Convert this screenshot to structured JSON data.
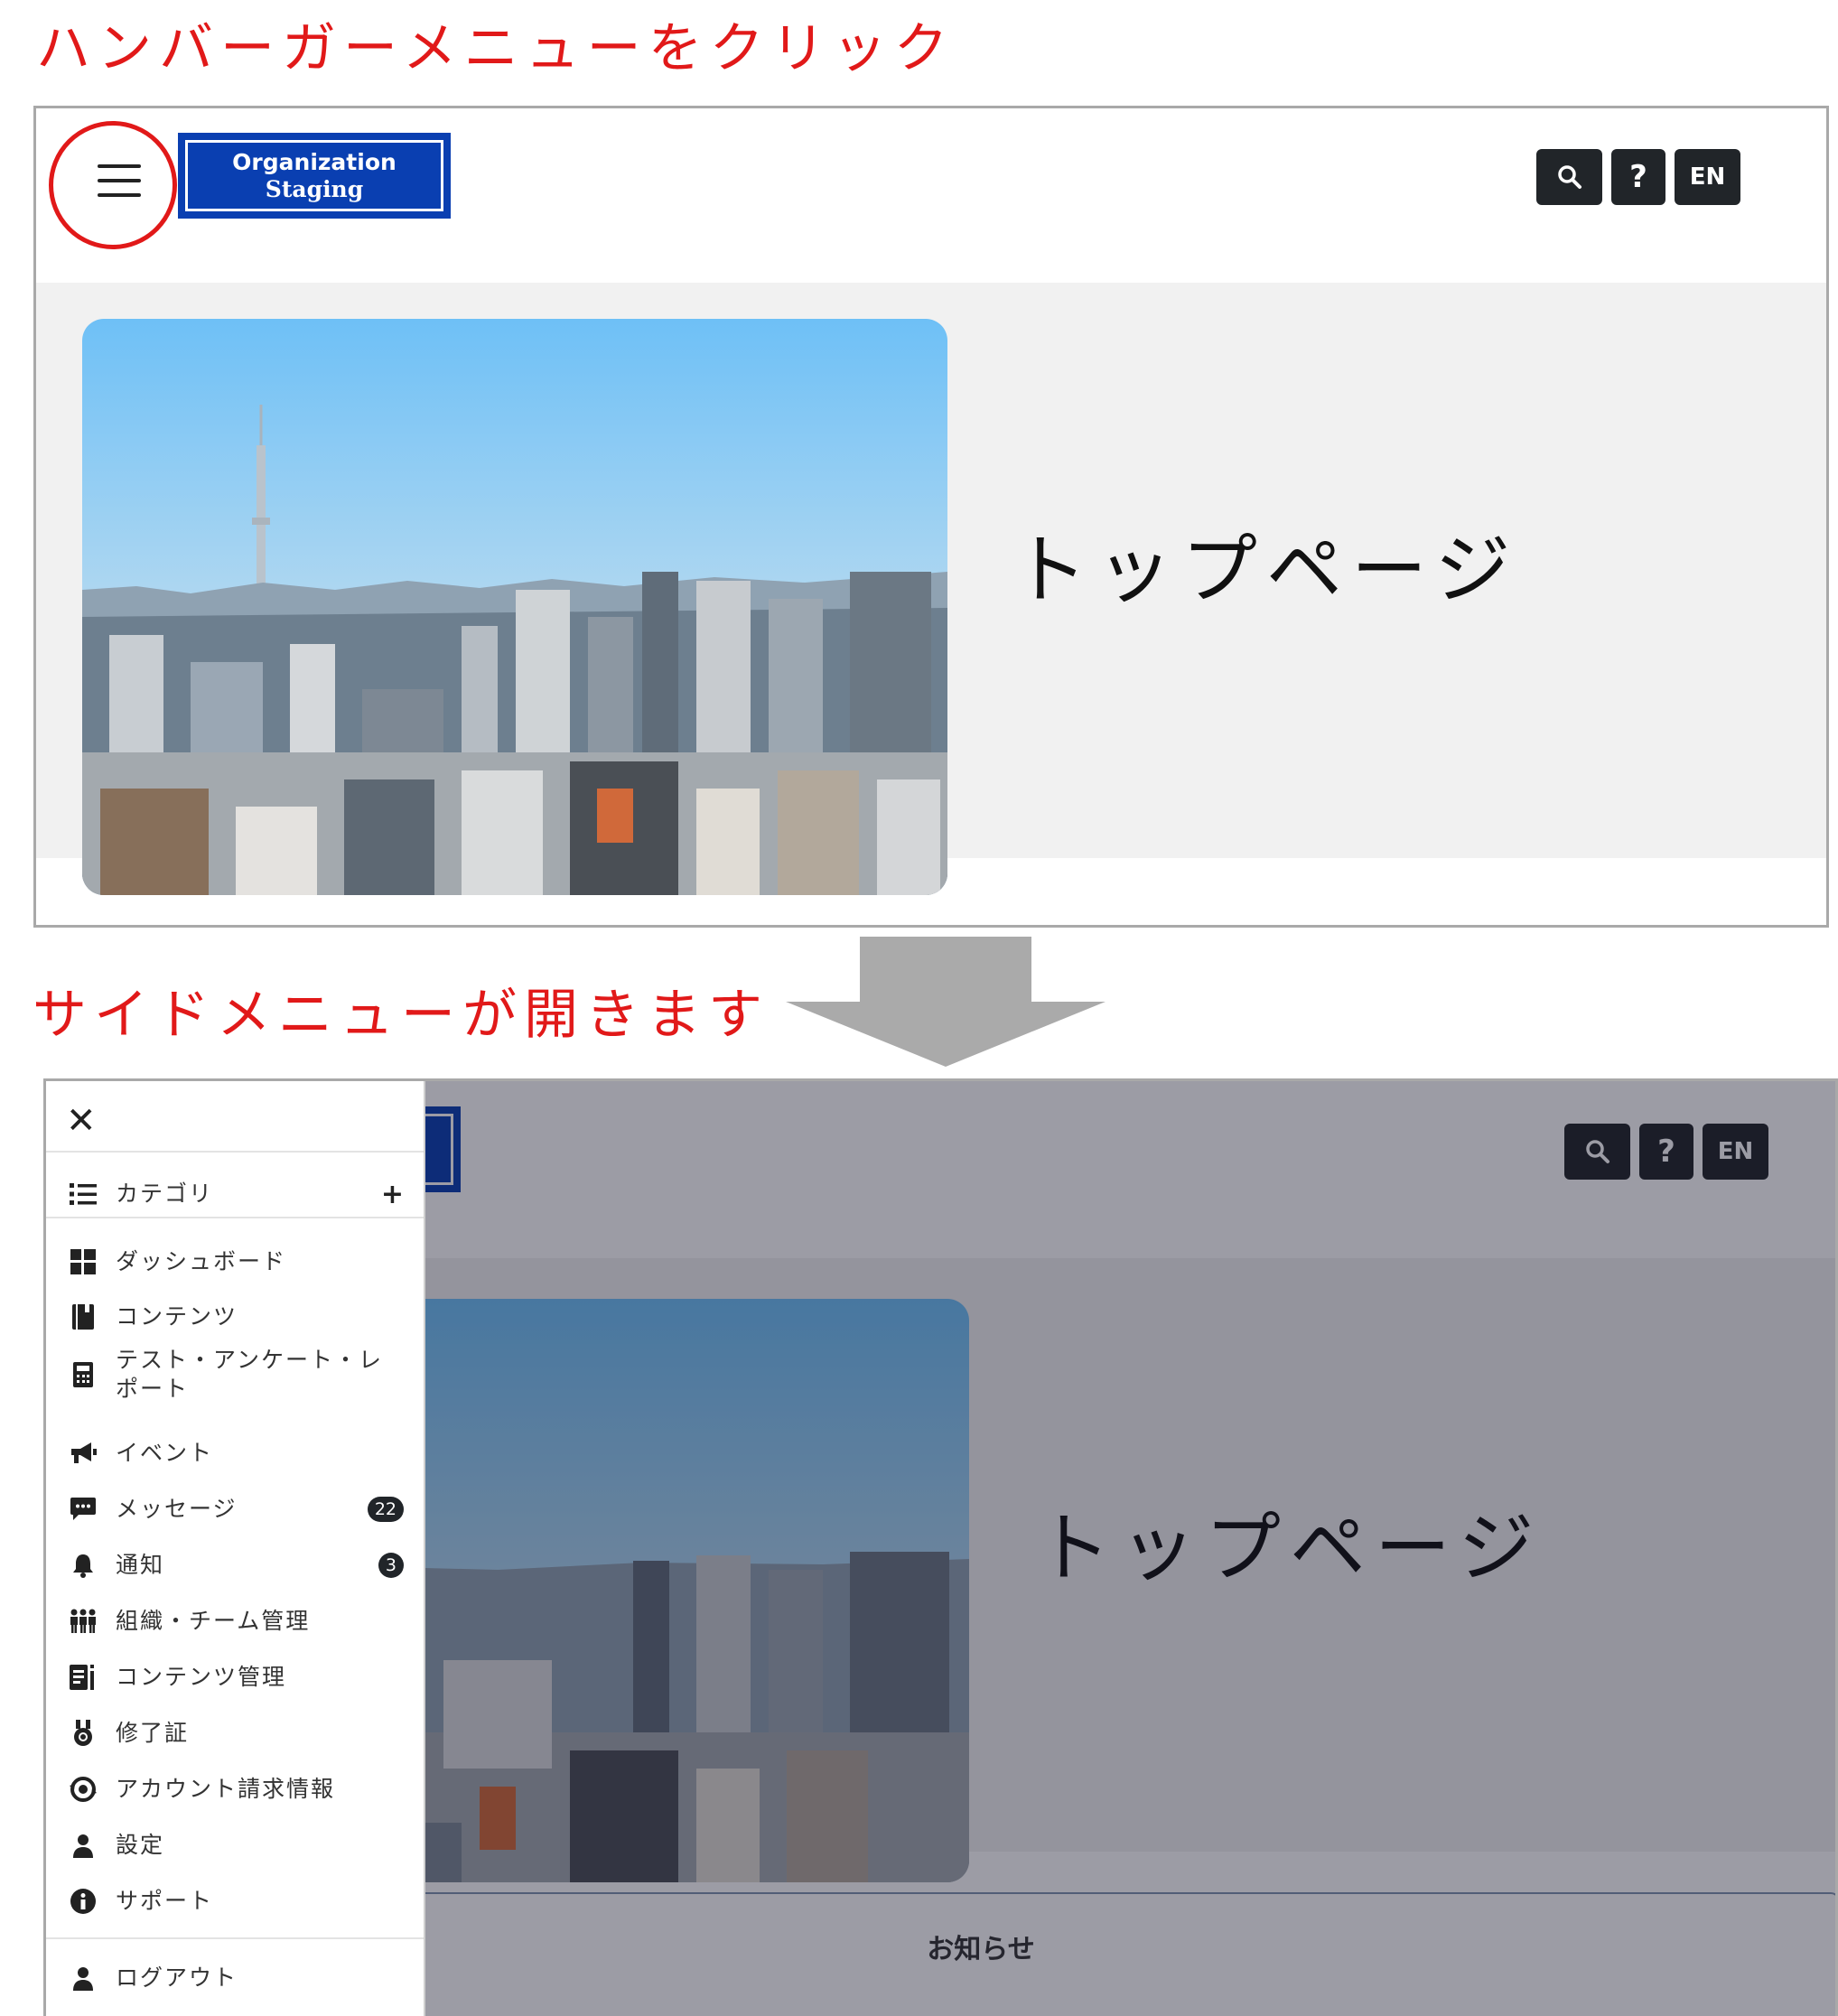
{
  "captions": {
    "step1": "ハンバーガーメニューをクリック",
    "step2": "サイドメニューが開きます"
  },
  "header": {
    "logo_line1": "Organization",
    "logo_line2": "Staging",
    "lang_label": "EN",
    "help_label": "?"
  },
  "hero": {
    "title": "トップページ"
  },
  "notice": {
    "title": "お知らせ"
  },
  "side_menu": {
    "close_label": "✕",
    "category": {
      "label": "カテゴリ",
      "expand": "+"
    },
    "items": [
      {
        "label": "ダッシュボード",
        "icon": "dashboard-icon"
      },
      {
        "label": "コンテンツ",
        "icon": "book-icon"
      },
      {
        "label": "テスト・アンケート・レポート",
        "icon": "calculator-icon"
      },
      {
        "label": "イベント",
        "icon": "megaphone-icon"
      },
      {
        "label": "メッセージ",
        "icon": "message-icon",
        "badge": "22"
      },
      {
        "label": "通知",
        "icon": "bell-icon",
        "badge": "3"
      },
      {
        "label": "組織・チーム管理",
        "icon": "team-icon"
      },
      {
        "label": "コンテンツ管理",
        "icon": "content-manage-icon"
      },
      {
        "label": "修了証",
        "icon": "medal-icon"
      },
      {
        "label": "アカウント請求情報",
        "icon": "billing-icon"
      },
      {
        "label": "設定",
        "icon": "user-icon"
      },
      {
        "label": "サポート",
        "icon": "info-icon"
      }
    ],
    "logout": {
      "label": "ログアウト",
      "icon": "user-icon"
    }
  },
  "colors": {
    "caption_red": "#e11919",
    "logo_blue": "#0a3fb1",
    "button_dark": "#212529",
    "hero_bg": "#f1f1f1"
  }
}
